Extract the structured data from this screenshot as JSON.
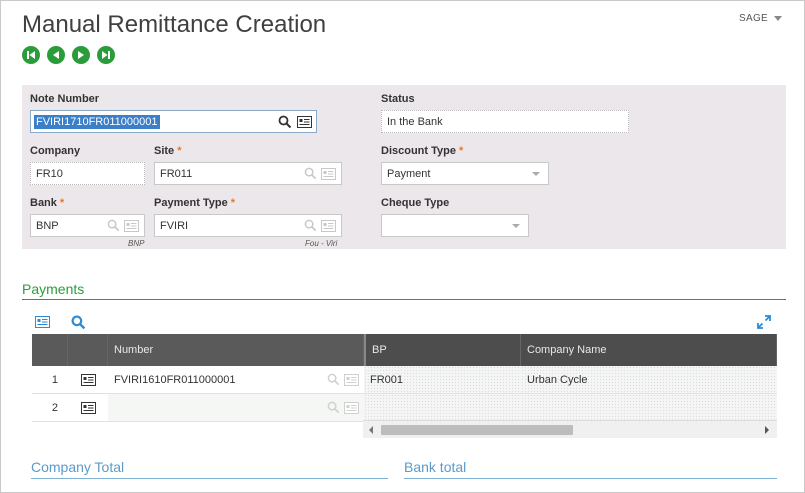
{
  "page": {
    "title": "Manual Remittance Creation",
    "user_menu": "SAGE"
  },
  "colors": {
    "accent_green": "#2a9d3a",
    "panel_bg": "#ece7ea",
    "grid_header": "#4d4d4d",
    "section_blue": "#5a9bc9",
    "required_asterisk": "#e8782b"
  },
  "nav": {
    "first": "nav-first-icon",
    "previous": "nav-previous-icon",
    "next": "nav-next-icon",
    "last": "nav-last-icon"
  },
  "form": {
    "note_number": {
      "label": "Note Number",
      "value": "FVIRI1710FR011000001"
    },
    "status": {
      "label": "Status",
      "value": "In the Bank"
    },
    "company": {
      "label": "Company",
      "value": "FR10"
    },
    "site": {
      "label": "Site",
      "value": "FR011",
      "required": "*"
    },
    "discount_type": {
      "label": "Discount Type",
      "value": "Payment",
      "required": "*"
    },
    "bank": {
      "label": "Bank",
      "value": "BNP",
      "hint": "BNP",
      "required": "*"
    },
    "payment_type": {
      "label": "Payment Type",
      "value": "FVIRI",
      "hint": "Fou - Viri",
      "required": "*"
    },
    "cheque_type": {
      "label": "Cheque Type",
      "value": ""
    }
  },
  "payments": {
    "title": "Payments",
    "columns": [
      "",
      "",
      "Number",
      "BP",
      "Company Name"
    ],
    "rows": [
      {
        "index": "1",
        "number": "FVIRI1610FR011000001",
        "bp": "FR001",
        "company_name": "Urban Cycle"
      },
      {
        "index": "2",
        "number": "",
        "bp": "",
        "company_name": ""
      }
    ]
  },
  "totals": {
    "company_total": "Company Total",
    "bank_total": "Bank total"
  }
}
